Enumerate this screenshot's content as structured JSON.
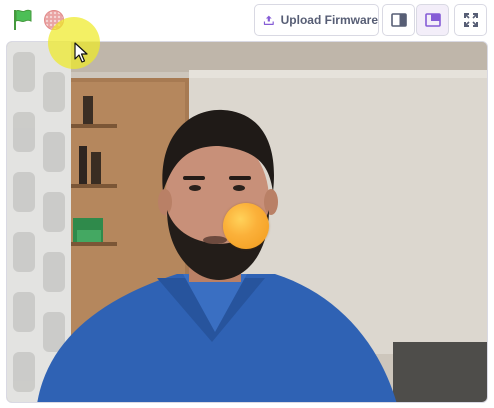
{
  "toolbar": {
    "green_flag_icon": "green-flag-icon",
    "stop_icon": "stop-icon",
    "hidden_label": "",
    "upload_label": "Upload Firmware",
    "upload_icon": "upload-icon",
    "small_stage_icon": "small-stage-icon",
    "large_stage_icon": "large-stage-icon",
    "fullscreen_icon": "fullscreen-icon",
    "accent_color": "#855cd6",
    "flag_color": "#4cbf56",
    "stop_color": "#ec5959"
  },
  "stage": {
    "content": "webcam-video-feed",
    "sprite": "orange-ball-sprite",
    "sprite_color": "#fbb13a"
  }
}
